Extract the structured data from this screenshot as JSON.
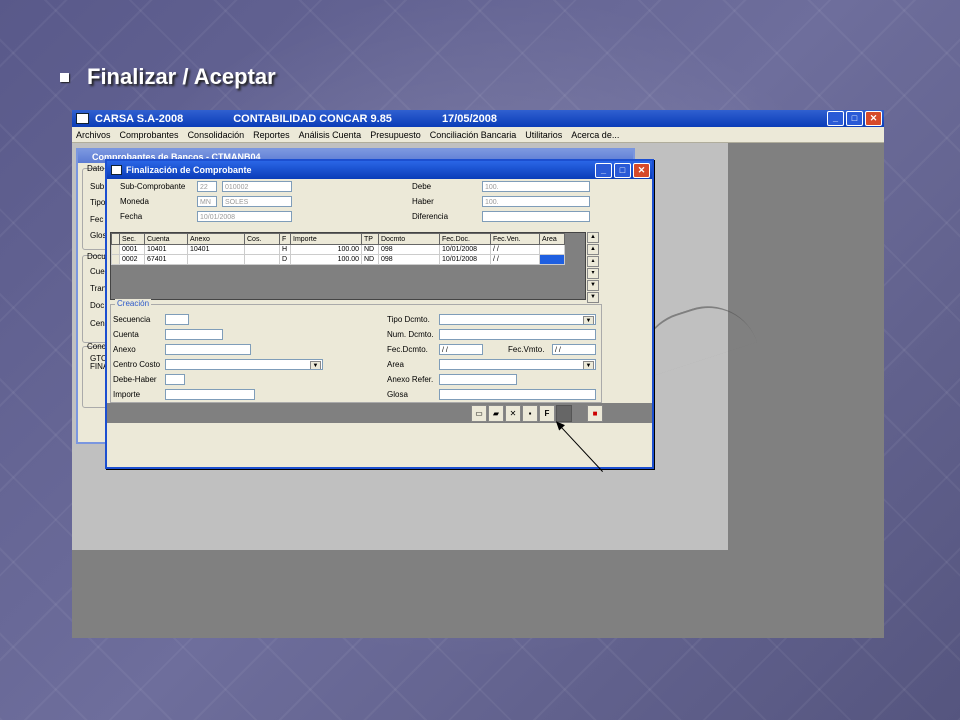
{
  "slide": {
    "title": "Finalizar / Aceptar"
  },
  "app": {
    "title_company": "CARSA S.A-2008",
    "title_product": "CONTABILIDAD CONCAR 9.85",
    "title_date": "17/05/2008",
    "menu": [
      "Archivos",
      "Comprobantes",
      "Consolidación",
      "Reportes",
      "Análisis Cuenta",
      "Presupuesto",
      "Conciliación Bancaria",
      "Utilitarios",
      "Acerca de..."
    ]
  },
  "back_window": {
    "title": "Comprobantes de Bancos - CTMANB04",
    "labels": [
      "Dato",
      "Sub",
      "Tipo",
      "Fec",
      "Glos",
      "Docu",
      "Cue",
      "Tran",
      "Doc",
      "Cen",
      "Conc",
      "GTO",
      "FINA"
    ]
  },
  "dialog": {
    "title": "Finalización de Comprobante",
    "sub_comprobante_label": "Sub-Comprobante",
    "sub_comprobante_code": "22",
    "sub_comprobante_num": "010002",
    "moneda_label": "Moneda",
    "moneda_code": "MN",
    "moneda_name": "SOLES",
    "fecha_label": "Fecha",
    "fecha_value": "10/01/2008",
    "debe_label": "Debe",
    "debe_value": "100.",
    "haber_label": "Haber",
    "haber_value": "100.",
    "diferencia_label": "Diferencia",
    "diferencia_value": "",
    "grid": {
      "headers": [
        "Sec.",
        "Cuenta",
        "Anexo",
        "Cos.",
        "F",
        "Importe",
        "TP",
        "Docmto",
        "Fec.Doc.",
        "Fec.Ven.",
        "Area"
      ],
      "rows": [
        [
          "0001",
          "10401",
          "10401",
          "",
          "H",
          "100.00",
          "ND",
          "098",
          "10/01/2008",
          "/ /",
          ""
        ],
        [
          "0002",
          "67401",
          "",
          "",
          "D",
          "100.00",
          "ND",
          "098",
          "10/01/2008",
          "/ /",
          ""
        ]
      ]
    },
    "creacion": {
      "legend": "Creación",
      "secuencia": "Secuencia",
      "cuenta": "Cuenta",
      "anexo": "Anexo",
      "centro_costo": "Centro Costo",
      "debe_haber": "Debe-Haber",
      "importe": "Importe",
      "tipo_dcmto": "Tipo Dcmto.",
      "num_dcmto": "Num. Dcmto.",
      "fec_dcmto": "Fec.Dcmto.",
      "fec_dcmto_value": "/ /",
      "fec_vmto": "Fec.Vmto.",
      "fec_vmto_value": "/ /",
      "area": "Area",
      "anexo_refer": "Anexo Refer.",
      "glosa": "Glosa"
    },
    "toolbar": {
      "finalize_label": "F"
    }
  }
}
